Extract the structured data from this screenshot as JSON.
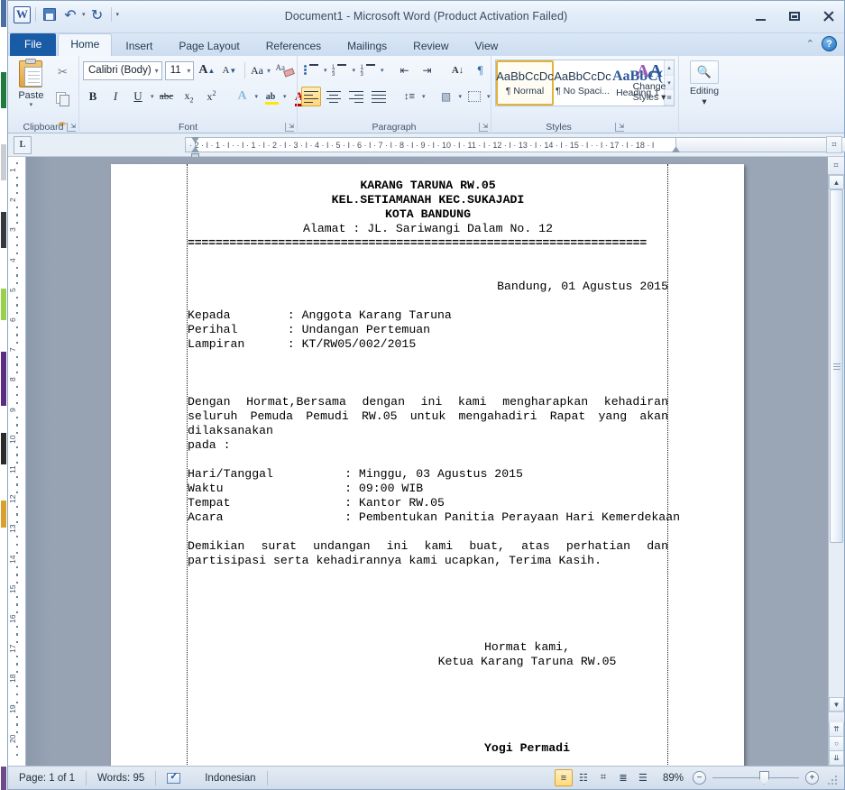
{
  "window": {
    "title": "Document1  -  Microsoft Word (Product Activation Failed)",
    "minimize_label": "Minimize",
    "maximize_label": "Restore Down",
    "close_label": "Close"
  },
  "quick_access": {
    "app_logo": "W",
    "items": [
      {
        "name": "save",
        "label": "Save"
      },
      {
        "name": "undo",
        "label": "Undo",
        "glyph": "↶"
      },
      {
        "name": "redo",
        "label": "Redo",
        "glyph": "↻"
      },
      {
        "name": "customize",
        "label": "Customize Quick Access Toolbar",
        "glyph": "▾"
      }
    ]
  },
  "tabs": {
    "file": "File",
    "items": [
      "Home",
      "Insert",
      "Page Layout",
      "References",
      "Mailings",
      "Review",
      "View"
    ],
    "active": "Home",
    "collapse_ribbon_glyph": "⌃",
    "help_glyph": "?"
  },
  "ribbon": {
    "groups": [
      {
        "name": "clipboard",
        "label": "Clipboard",
        "paste_label": "Paste",
        "paste_caret": "▾",
        "buttons": [
          {
            "name": "cut",
            "label": "Cut",
            "glyph": "✂"
          },
          {
            "name": "copy",
            "label": "Copy"
          },
          {
            "name": "format-painter",
            "label": "Format Painter",
            "glyph": "✒"
          }
        ]
      },
      {
        "name": "font",
        "label": "Font",
        "font_name": "Calibri (Body)",
        "font_size": "11",
        "caret": "▾",
        "grow_font": "A",
        "shrink_font": "A",
        "change_case": "Aa",
        "clear_formatting": "Clear Formatting",
        "bold": "B",
        "italic": "I",
        "underline": "U",
        "strikethrough": "abc",
        "subscript": "x",
        "subscript_idx": "2",
        "superscript": "x",
        "superscript_idx": "2",
        "text_effects": "A",
        "highlight": "ab",
        "font_color": "A"
      },
      {
        "name": "paragraph",
        "label": "Paragraph",
        "bullets": "Bullets",
        "numbering": "Numbering",
        "multilevel": "Multilevel List",
        "decrease_indent": "Decrease Indent",
        "increase_indent": "Increase Indent",
        "sort": "Sort",
        "sort_glyph": "A↓",
        "show_marks": "¶",
        "align_left": "Align Text Left",
        "center": "Center",
        "align_right": "Align Text Right",
        "justify": "Justify",
        "line_spacing": "Line and Paragraph Spacing",
        "shading": "Shading",
        "borders": "Borders",
        "active_align": "Align Text Left"
      },
      {
        "name": "styles",
        "label": "Styles",
        "gallery": [
          {
            "preview": "AaBbCcDc",
            "name": "¶ Normal",
            "selected": true
          },
          {
            "preview": "AaBbCcDc",
            "name": "¶ No Spaci...",
            "selected": false
          },
          {
            "preview": "AaBbC(",
            "name": "Heading 1",
            "selected": false,
            "heading": true
          }
        ],
        "scroll_up": "▴",
        "scroll_down": "▾",
        "more": "≣",
        "change_styles_line1": "Change",
        "change_styles_line2": "Styles ▾"
      },
      {
        "name": "editing",
        "label": "",
        "editing_label": "Editing",
        "editing_caret": "▾",
        "editing_glyph": "☎"
      }
    ]
  },
  "ruler": {
    "tab_stop_selector": "L",
    "horizontal_ticks": "· 2 · I · 1 · I ·   · I · 1 · I · 2 · I · 3 · I · 4 · I · 5 · I · 6 · I · 7 · I · 8 · I · 9 · I · 10 · I · 11 · I · 12 · I · 13 · I · 14 · I · 15 · I ·   · I · 17 · I · 18 · I",
    "vertical_numbers": [
      "1",
      "2",
      "3",
      "4",
      "5",
      "6",
      "7",
      "8",
      "9",
      "10",
      "11",
      "12",
      "13",
      "14",
      "15",
      "16",
      "17",
      "18",
      "19",
      "20"
    ]
  },
  "document": {
    "lines": [
      {
        "text": "KARANG TARUNA RW.05",
        "align": "center",
        "bold": true
      },
      {
        "text": "KEL.SETIAMANAH KEC.SUKAJADI",
        "align": "center",
        "bold": true
      },
      {
        "text": "KOTA BANDUNG",
        "align": "center",
        "bold": true
      },
      {
        "text": "Alamat : JL. Sariwangi Dalam No. 12",
        "align": "center",
        "bold": false
      },
      {
        "text": "==================================================================",
        "align": "left",
        "bold": true,
        "rule": true
      },
      {
        "text": "",
        "align": "left",
        "bold": false
      },
      {
        "text": "",
        "align": "left",
        "bold": false
      },
      {
        "text": "Bandung, 01 Agustus 2015",
        "align": "right",
        "bold": false
      },
      {
        "text": "",
        "align": "left",
        "bold": false
      },
      {
        "text": "Kepada        : Anggota Karang Taruna",
        "align": "left",
        "bold": false
      },
      {
        "text": "Perihal       : Undangan Pertemuan",
        "align": "left",
        "bold": false
      },
      {
        "text": "Lampiran      : KT/RW05/002/2015",
        "align": "left",
        "bold": false
      },
      {
        "text": "",
        "align": "left",
        "bold": false
      },
      {
        "text": "",
        "align": "left",
        "bold": false
      },
      {
        "text": "",
        "align": "left",
        "bold": false
      },
      {
        "text": "Dengan Hormat,Bersama dengan ini kami mengharapkan kehadiran seluruh Pemuda Pemudi RW.05 untuk mengahadiri Rapat yang akan dilaksanakan",
        "align": "justify",
        "bold": false,
        "wrap": true
      },
      {
        "text": "pada :",
        "align": "left",
        "bold": false
      },
      {
        "text": "",
        "align": "left",
        "bold": false
      },
      {
        "text": "Hari/Tanggal          : Minggu, 03 Agustus 2015",
        "align": "left",
        "bold": false
      },
      {
        "text": "Waktu                 : 09:00 WIB",
        "align": "left",
        "bold": false
      },
      {
        "text": "Tempat                : Kantor RW.05",
        "align": "left",
        "bold": false
      },
      {
        "text": "Acara                 : Pembentukan Panitia Perayaan Hari Kemerdekaan",
        "align": "left",
        "bold": false
      },
      {
        "text": "",
        "align": "left",
        "bold": false
      },
      {
        "text": "Demikian  surat  undangan  ini  kami  buat,  atas  perhatian  dan partisipasi serta kehadirannya kami ucapkan, Terima Kasih.",
        "align": "justify",
        "bold": false,
        "wrap": true
      },
      {
        "text": "",
        "align": "left",
        "bold": false
      },
      {
        "text": "",
        "align": "left",
        "bold": false
      },
      {
        "text": "",
        "align": "left",
        "bold": false
      },
      {
        "text": "",
        "align": "left",
        "bold": false
      },
      {
        "text": "",
        "align": "left",
        "bold": false
      },
      {
        "text": "Hormat kami,",
        "align": "sig",
        "bold": false
      },
      {
        "text": "Ketua Karang Taruna RW.05",
        "align": "sig",
        "bold": false
      },
      {
        "text": "",
        "align": "left",
        "bold": false
      },
      {
        "text": "",
        "align": "left",
        "bold": false
      },
      {
        "text": "",
        "align": "left",
        "bold": false
      },
      {
        "text": "",
        "align": "left",
        "bold": false
      },
      {
        "text": "",
        "align": "left",
        "bold": false
      },
      {
        "text": "Yogi Permadi",
        "align": "sig",
        "bold": true
      }
    ]
  },
  "status_bar": {
    "page": "Page: 1 of 1",
    "words": "Words: 95",
    "language": "Indonesian",
    "proofing_label": "Proofing errors",
    "views": [
      {
        "name": "print-layout",
        "glyph": "≡",
        "selected": true
      },
      {
        "name": "full-screen-reading",
        "glyph": "☷",
        "selected": false
      },
      {
        "name": "web-layout",
        "glyph": "⌗",
        "selected": false
      },
      {
        "name": "outline",
        "glyph": "≣",
        "selected": false
      },
      {
        "name": "draft",
        "glyph": "☰",
        "selected": false
      }
    ],
    "zoom": "89%",
    "zoom_out": "−",
    "zoom_in": "+"
  },
  "scrollbar": {
    "up_glyph": "▲",
    "down_glyph": "▼",
    "prev_page_glyph": "⇈",
    "select_object_glyph": "○",
    "next_page_glyph": "⇊",
    "page_corner_glyph": "⌗"
  }
}
